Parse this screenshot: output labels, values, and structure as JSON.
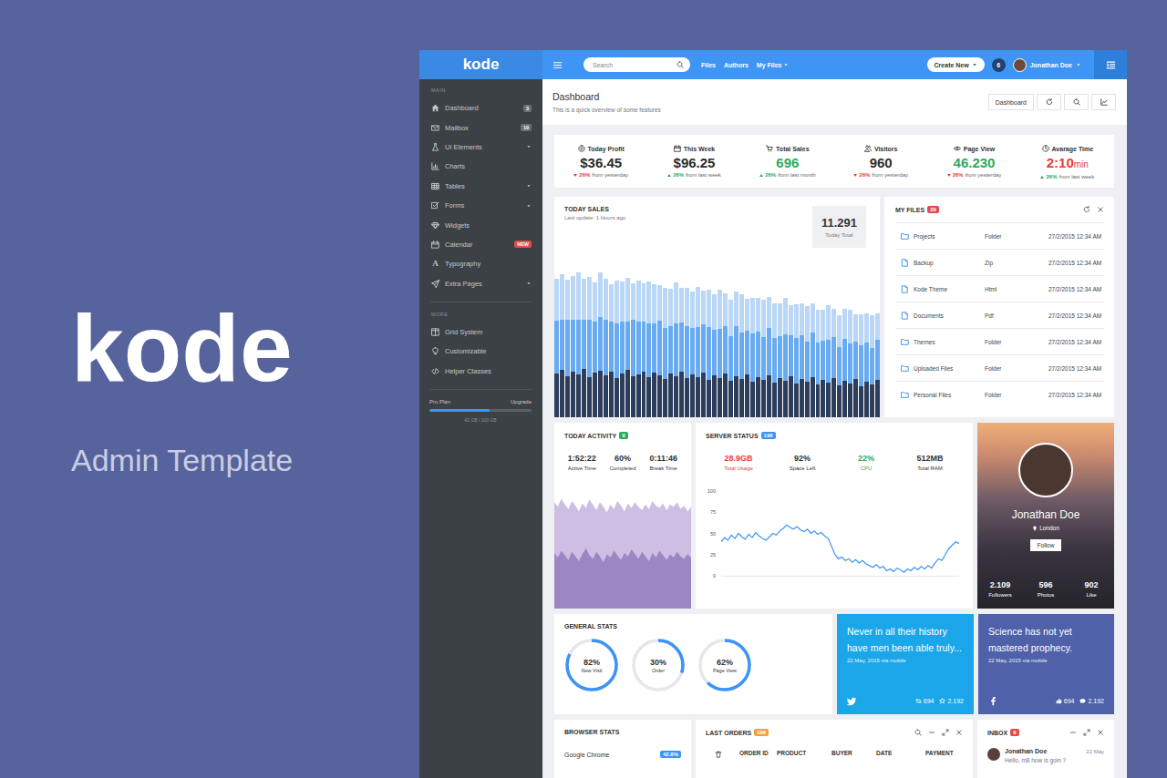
{
  "hero": {
    "logo": "kode",
    "subtitle": "Admin Template"
  },
  "topbar": {
    "logo": "kode",
    "search": {
      "placeholder": "Search"
    },
    "links": [
      {
        "label": "Files",
        "dropdown": false
      },
      {
        "label": "Authors",
        "dropdown": false
      },
      {
        "label": "My Files",
        "dropdown": true
      }
    ],
    "create_button": {
      "label": "Create New",
      "dropdown": true
    },
    "notifications": "6",
    "user": {
      "name": "Jonathan Doe",
      "dropdown": true
    }
  },
  "sidebar": {
    "sections": [
      {
        "title": "MAIN",
        "items": [
          {
            "label": "Dashboard",
            "badge": {
              "text": "3",
              "color": "#6b7075"
            },
            "submenu": false
          },
          {
            "label": "Mailbox",
            "badge": {
              "text": "19",
              "color": "#6b7075"
            },
            "submenu": false
          },
          {
            "label": "UI Elements",
            "badge": null,
            "submenu": true
          },
          {
            "label": "Charts",
            "badge": null,
            "submenu": false
          },
          {
            "label": "Tables",
            "badge": null,
            "submenu": true
          },
          {
            "label": "Forms",
            "badge": null,
            "submenu": true
          },
          {
            "label": "Widgets",
            "badge": null,
            "submenu": false
          },
          {
            "label": "Calendar",
            "badge": {
              "text": "NEW",
              "color": "#e14b4b"
            },
            "submenu": false
          },
          {
            "label": "Typography",
            "icon_text": "A",
            "badge": null,
            "submenu": false
          },
          {
            "label": "Extra Pages",
            "badge": null,
            "submenu": true
          }
        ]
      },
      {
        "title": "MORE",
        "items": [
          {
            "label": "Grid System",
            "badge": null,
            "submenu": false
          },
          {
            "label": "Customizable",
            "badge": null,
            "submenu": false
          },
          {
            "label": "Helper Classes",
            "badge": null,
            "submenu": false
          }
        ]
      }
    ],
    "plan": {
      "label": "Pro Plan",
      "action": "Upgrade",
      "level": 0.59,
      "usage": "42 GB / 100 GB"
    }
  },
  "page_header": {
    "title": "Dashboard",
    "subtitle": "This is a quick overview of some features",
    "button": "Dashboard"
  },
  "stats": [
    {
      "label": "Today Profit",
      "value": "$36.45",
      "unit": "",
      "color": "#2b2b2b",
      "change": "26%",
      "change_note": "from yesterday",
      "trend": "down"
    },
    {
      "label": "This Week",
      "value": "$96.25",
      "unit": "",
      "color": "#2b2b2b",
      "change": "26%",
      "change_note": "from last week",
      "trend": "up"
    },
    {
      "label": "Total Sales",
      "value": "696",
      "unit": "",
      "color": "#2eaa5c",
      "change": "26%",
      "change_note": "from last month",
      "trend": "up"
    },
    {
      "label": "Visitors",
      "value": "960",
      "unit": "",
      "color": "#2b2b2b",
      "change": "26%",
      "change_note": "from yesterday",
      "trend": "down"
    },
    {
      "label": "Page View",
      "value": "46.230",
      "unit": "",
      "color": "#2eaa5c",
      "change": "26%",
      "change_note": "from yesterday",
      "trend": "down"
    },
    {
      "label": "Avarage Time",
      "value": "2:10",
      "unit": "min",
      "color": "#e5413a",
      "change": "26%",
      "change_note": "from last week",
      "trend": "up"
    }
  ],
  "today_sales": {
    "title": "TODAY SALES",
    "subtitle": "Last update: 1 Hours ago",
    "total": "11.291",
    "total_label": "Today Total",
    "max": 160,
    "series": [
      {
        "color": "#2d3d5c",
        "values": [
          48,
          52,
          45,
          50,
          47,
          53,
          44,
          49,
          51,
          46,
          50,
          43,
          48,
          52,
          45,
          47,
          50,
          44,
          49,
          46,
          42,
          48,
          45,
          50,
          43,
          47,
          44,
          49,
          41,
          46,
          43,
          48,
          40,
          45,
          42,
          47,
          39,
          44,
          41,
          46,
          38,
          43,
          40,
          45,
          37,
          42,
          39,
          44,
          36,
          41,
          38,
          43,
          35,
          40,
          37,
          42,
          34,
          39,
          36,
          41
        ]
      },
      {
        "color": "#69abf0",
        "values": [
          58,
          55,
          62,
          57,
          60,
          54,
          63,
          56,
          59,
          61,
          55,
          60,
          57,
          53,
          62,
          58,
          55,
          59,
          54,
          60,
          56,
          52,
          58,
          54,
          57,
          51,
          55,
          53,
          58,
          50,
          54,
          52,
          49,
          55,
          51,
          48,
          53,
          50,
          47,
          52,
          49,
          46,
          51,
          45,
          50,
          48,
          44,
          49,
          46,
          43,
          47,
          45,
          42,
          46,
          44,
          41,
          45,
          43,
          40,
          44
        ]
      },
      {
        "color": "#bad7f6",
        "values": [
          46,
          50,
          44,
          48,
          52,
          45,
          47,
          43,
          49,
          45,
          41,
          47,
          44,
          48,
          40,
          45,
          42,
          46,
          43,
          39,
          44,
          41,
          45,
          38,
          42,
          40,
          44,
          37,
          41,
          39,
          43,
          36,
          40,
          38,
          42,
          35,
          39,
          37,
          41,
          34,
          38,
          36,
          40,
          33,
          37,
          35,
          39,
          32,
          36,
          34,
          38,
          31,
          35,
          33,
          37,
          30,
          34,
          32,
          36,
          29
        ]
      }
    ]
  },
  "my_files": {
    "title": "MY FILES",
    "badge": "29",
    "badge_color": "#e14b4b",
    "rows": [
      {
        "name": "Projects",
        "type": "Folder",
        "date": "27/2/2015 12:34 AM",
        "kind": "folder"
      },
      {
        "name": "Backup",
        "type": "Zip",
        "date": "27/2/2015 12:34 AM",
        "kind": "file"
      },
      {
        "name": "Kode Theme",
        "type": "Html",
        "date": "27/2/2015 12:34 AM",
        "kind": "file"
      },
      {
        "name": "Documents",
        "type": "Pdf",
        "date": "27/2/2015 12:34 AM",
        "kind": "file"
      },
      {
        "name": "Themes",
        "type": "Folder",
        "date": "27/2/2015 12:34 AM",
        "kind": "folder"
      },
      {
        "name": "Uploaded Files",
        "type": "Folder",
        "date": "27/2/2015 12:34 AM",
        "kind": "folder"
      },
      {
        "name": "Personal Files",
        "type": "Folder",
        "date": "27/2/2015 12:34 AM",
        "kind": "folder"
      }
    ]
  },
  "activity": {
    "title": "TODAY ACTIVITY",
    "badge": "9",
    "badge_color": "#2eaa5c",
    "stats": [
      {
        "value": "1:52:22",
        "label": "Active Time"
      },
      {
        "value": "60%",
        "label": "Completed"
      },
      {
        "value": "0:11:46",
        "label": "Break Time"
      }
    ],
    "series": [
      {
        "color": "#cdbfe3",
        "values": [
          92,
          88,
          95,
          90,
          86,
          93,
          89,
          84,
          91,
          87,
          94,
          90,
          85,
          92,
          88,
          83,
          90,
          86,
          93,
          89,
          84,
          91,
          87,
          92,
          88,
          85,
          90,
          86,
          93,
          89,
          87,
          91,
          85,
          90,
          88,
          92,
          86,
          89,
          84,
          88
        ]
      },
      {
        "color": "#9c86c3",
        "values": [
          48,
          44,
          50,
          46,
          42,
          49,
          45,
          41,
          47,
          52,
          46,
          43,
          49,
          45,
          40,
          47,
          44,
          50,
          46,
          42,
          48,
          45,
          51,
          47,
          43,
          49,
          45,
          41,
          48,
          44,
          50,
          46,
          42,
          47,
          44,
          49,
          45,
          43,
          47,
          44
        ]
      }
    ]
  },
  "server": {
    "title": "SERVER STATUS",
    "badge": "196",
    "badge_color": "#3d94f6",
    "stats": [
      {
        "value": "28.9GB",
        "label": "Total Usage",
        "color": "#e5413a"
      },
      {
        "value": "92%",
        "label": "Space Left",
        "color": "#333333"
      },
      {
        "value": "22%",
        "label": "CPU",
        "color": "#2eaa5c"
      },
      {
        "value": "512MB",
        "label": "Total RAM",
        "color": "#333333"
      }
    ],
    "chart": {
      "ticks": [
        "100",
        "75",
        "50",
        "25",
        "0"
      ],
      "color": "#3d94f6",
      "values": [
        40,
        45,
        42,
        48,
        44,
        50,
        46,
        43,
        49,
        45,
        51,
        47,
        44,
        42,
        46,
        50,
        48,
        53,
        56,
        60,
        57,
        55,
        58,
        54,
        52,
        55,
        50,
        53,
        49,
        51,
        47,
        44,
        35,
        25,
        20,
        22,
        18,
        20,
        16,
        19,
        15,
        18,
        14,
        12,
        10,
        13,
        9,
        11,
        6,
        8,
        5,
        9,
        7,
        4,
        8,
        6,
        10,
        7,
        11,
        8,
        12,
        9,
        15,
        20,
        18,
        25,
        32,
        36,
        40,
        38
      ]
    }
  },
  "profile": {
    "name": "Jonathan Doe",
    "location": "London",
    "button": "Follow",
    "stats": [
      {
        "value": "2.109",
        "label": "Followers"
      },
      {
        "value": "596",
        "label": "Photos"
      },
      {
        "value": "902",
        "label": "Like"
      }
    ]
  },
  "general_stats": {
    "title": "GENERAL STATS",
    "circles": [
      {
        "value": "82%",
        "label": "New Visit",
        "level": 0.82
      },
      {
        "value": "30%",
        "label": "Order",
        "level": 0.3
      },
      {
        "value": "62%",
        "label": "Page View",
        "level": 0.62
      }
    ]
  },
  "posts": [
    {
      "kind": "twitter",
      "color": "#1ba6ea",
      "text": "Never in all their history have men been able truly...",
      "date": "22 May, 2015 via mobile",
      "counts": [
        "694",
        "2.192"
      ]
    },
    {
      "kind": "facebook",
      "color": "#4e61a9",
      "text": "Science has not yet mastered prophecy.",
      "date": "22 May, 2015 via mobile",
      "counts": [
        "694",
        "2.192"
      ]
    }
  ],
  "browser_stats": {
    "title": "BROWSER STATS",
    "rows": [
      {
        "name": "Google Chrome",
        "share": "42.8%"
      }
    ]
  },
  "last_orders": {
    "title": "LAST ORDERS",
    "badge": "196",
    "badge_color": "#f0a23a",
    "columns": [
      "ORDER ID",
      "PRODUCT",
      "BUYER",
      "DATE",
      "PAYMENT"
    ]
  },
  "inbox": {
    "title": "INBOX",
    "badge": "9",
    "badge_color": "#e14b4b",
    "messages": [
      {
        "from": "Jonathan Doe",
        "date": "22 May",
        "text": "Hello, m8 how is goin ?"
      }
    ]
  }
}
